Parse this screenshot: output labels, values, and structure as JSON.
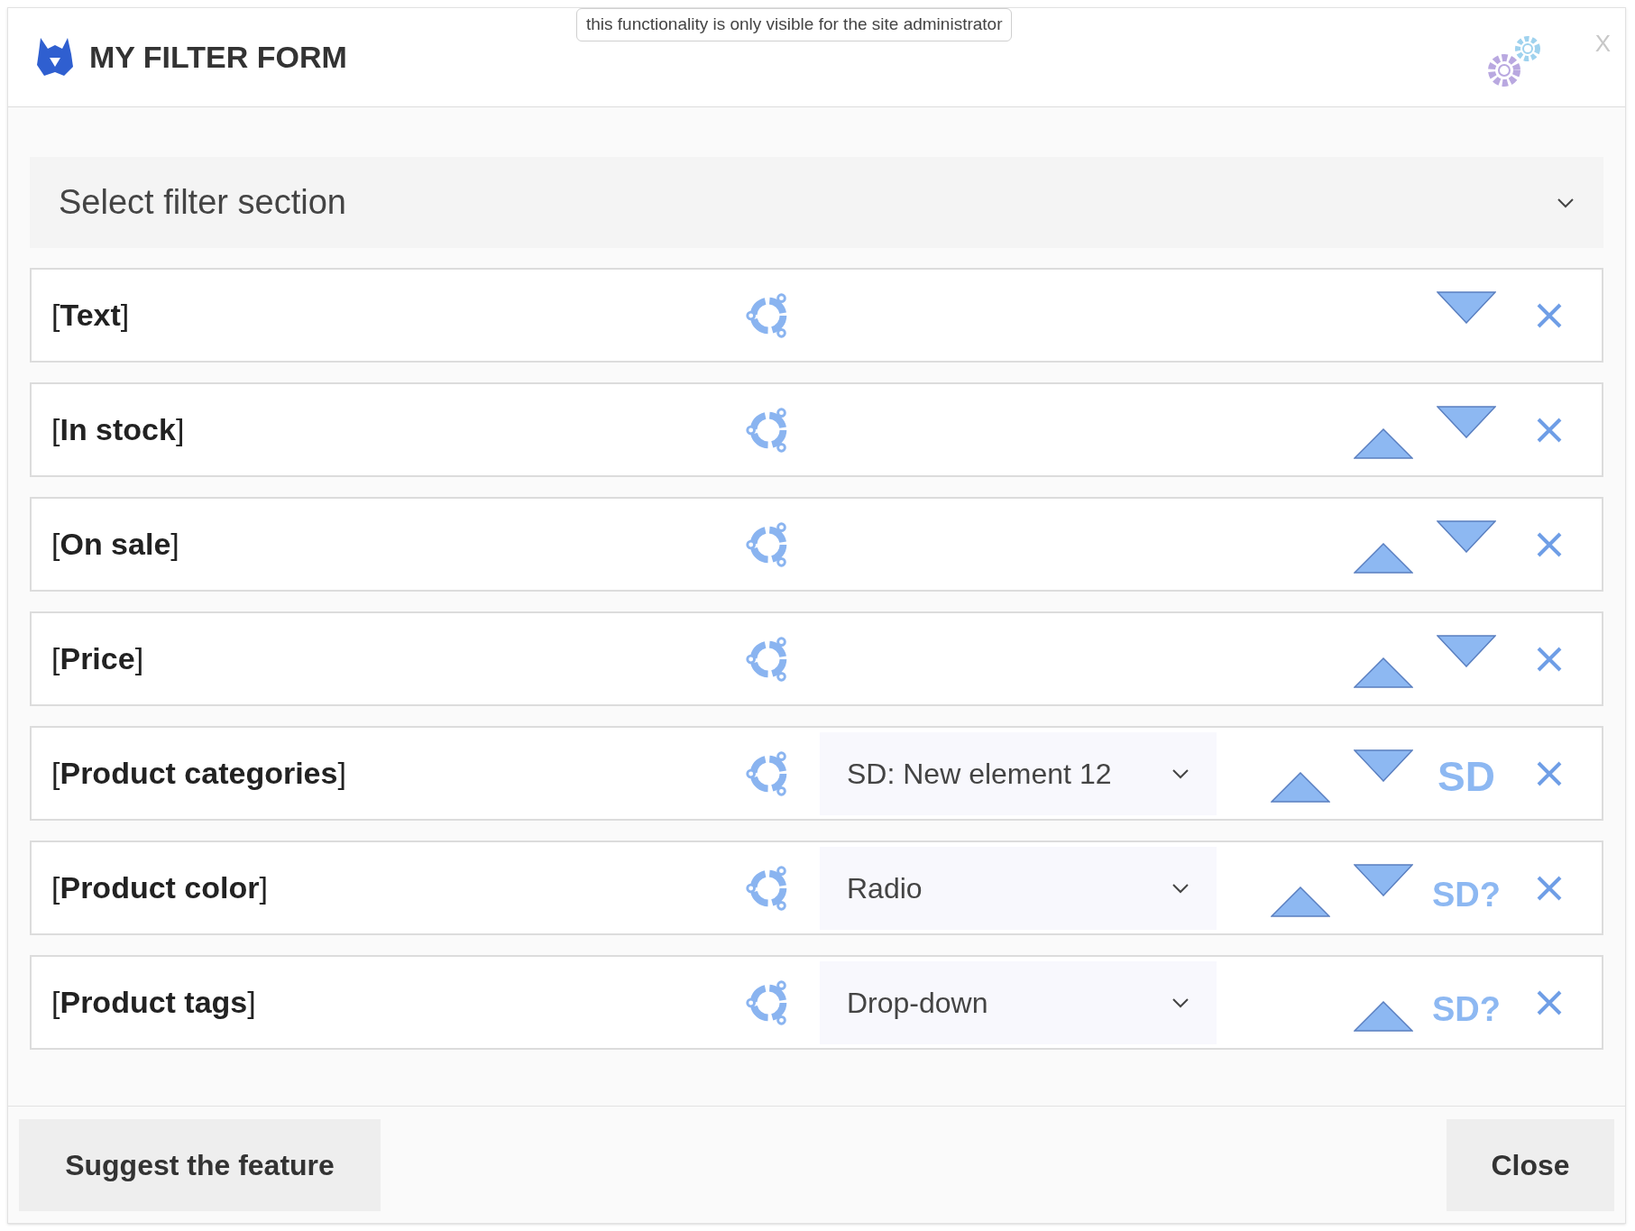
{
  "header": {
    "title": "MY FILTER FORM",
    "admin_note": "this functionality is only visible for the site administrator",
    "close": "X"
  },
  "section_select": {
    "placeholder": "Select filter section"
  },
  "filters": [
    {
      "label": "[**Text**]",
      "move_up": false,
      "move_down": true
    },
    {
      "label": "[**In stock**]",
      "move_up": true,
      "move_down": true
    },
    {
      "label": "[**On sale**]",
      "move_up": true,
      "move_down": true
    },
    {
      "label": "[**Price**]",
      "move_up": true,
      "move_down": true
    },
    {
      "label": "[**Product categories**]",
      "select": "SD: New element 12",
      "move_up": true,
      "move_down": true,
      "sd": {
        "text": "SD",
        "kind": "assigned"
      }
    },
    {
      "label": "[**Product color**]",
      "select": "Radio",
      "move_up": true,
      "move_down": true,
      "sd": {
        "text": "SD?",
        "kind": "unassigned"
      }
    },
    {
      "label": "[**Product tags**]",
      "select": "Drop-down",
      "move_up": true,
      "move_down": false,
      "sd": {
        "text": "SD?",
        "kind": "unassigned"
      }
    }
  ],
  "footer": {
    "buttons": [
      "Suggest the feature",
      "Close"
    ]
  }
}
